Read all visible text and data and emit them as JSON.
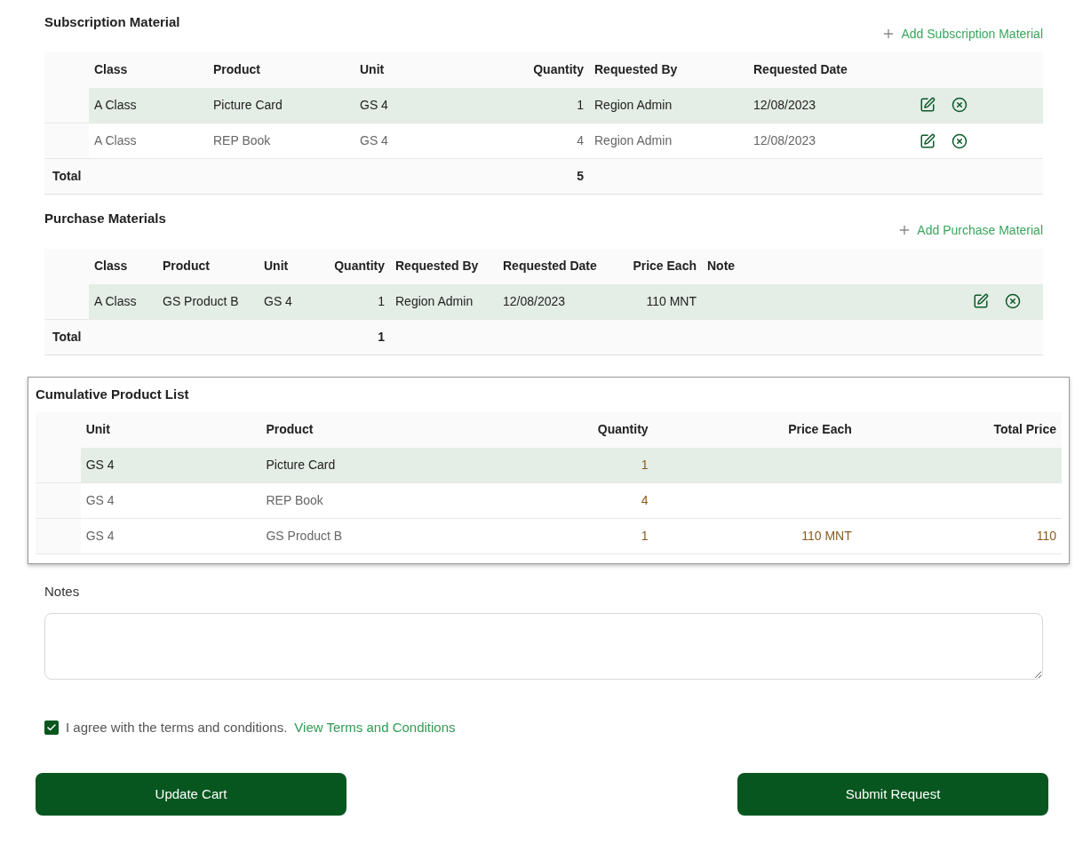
{
  "subscription": {
    "title": "Subscription Material",
    "add_label": "Add Subscription Material",
    "columns": [
      "Class",
      "Product",
      "Unit",
      "Quantity",
      "Requested By",
      "Requested Date"
    ],
    "rows": [
      {
        "selected": true,
        "cells": [
          "A Class",
          "Picture Card",
          "GS 4",
          "1",
          "Region Admin",
          "12/08/2023"
        ]
      },
      {
        "selected": false,
        "cells": [
          "A Class",
          "REP Book",
          "GS 4",
          "4",
          "Region Admin",
          "12/08/2023"
        ]
      }
    ],
    "total": {
      "label": "Total",
      "quantity": "5"
    }
  },
  "purchase": {
    "title": "Purchase Materials",
    "add_label": "Add Purchase Material",
    "columns": [
      "Class",
      "Product",
      "Unit",
      "Quantity",
      "Requested By",
      "Requested Date",
      "Price Each",
      "Note"
    ],
    "rows": [
      {
        "selected": true,
        "cells": [
          "A Class",
          "GS Product B",
          "GS 4",
          "1",
          "Region Admin",
          "12/08/2023",
          "110 MNT"
        ]
      }
    ],
    "total": {
      "label": "Total",
      "quantity": "1"
    }
  },
  "cumulative": {
    "title": "Cumulative Product List",
    "columns": [
      "Unit",
      "Product",
      "Quantity",
      "Price Each",
      "Total Price"
    ],
    "rows": [
      {
        "selected": true,
        "cells": [
          "GS 4",
          "Picture Card",
          "1"
        ]
      },
      {
        "selected": false,
        "cells": [
          "GS 4",
          "REP Book",
          "4"
        ]
      },
      {
        "selected": false,
        "cells": [
          "GS 4",
          "GS Product B",
          "1",
          "110 MNT",
          "110"
        ]
      }
    ]
  },
  "notes": {
    "label": "Notes"
  },
  "terms": {
    "checked": true,
    "text": "I agree with the terms and conditions.",
    "link": "View Terms and Conditions"
  },
  "buttons": [
    "Update Cart",
    "Submit Request"
  ]
}
